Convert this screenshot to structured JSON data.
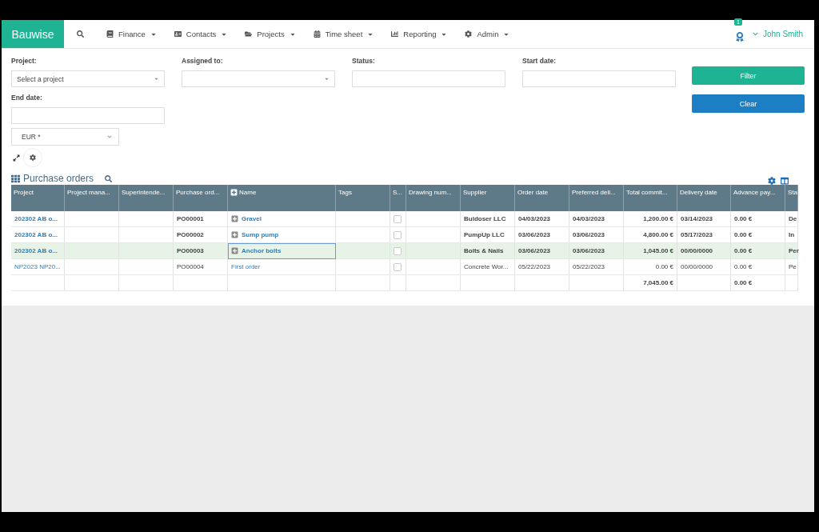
{
  "nav": {
    "brand": "Bauwise",
    "items": [
      {
        "label": "Finance"
      },
      {
        "label": "Contacts"
      },
      {
        "label": "Projects"
      },
      {
        "label": "Time sheet"
      },
      {
        "label": "Reporting"
      },
      {
        "label": "Admin"
      }
    ],
    "notification_count": "1",
    "user": "John Smith"
  },
  "filters": {
    "fields": [
      {
        "label": "Project:",
        "kind": "select",
        "placeholder": "Select a project"
      },
      {
        "label": "Assigned to:",
        "kind": "select"
      },
      {
        "label": "Status:",
        "kind": "input"
      },
      {
        "label": "Start date:",
        "kind": "input"
      },
      {
        "label": "End date:",
        "kind": "input"
      }
    ],
    "currency": "EUR *",
    "buttons": [
      {
        "label": "Filter",
        "kind": "primary"
      },
      {
        "label": "Clear",
        "kind": "secondary"
      }
    ]
  },
  "table": {
    "title": "Purchase orders",
    "columns": [
      "Project",
      "Project mana...",
      "Superintende...",
      "Purchase ord...",
      "Name",
      "Tags",
      "S...",
      "Drawing num...",
      "Supplier",
      "Order date",
      "Preferred deli...",
      "Total commit...",
      "Delivery date",
      "Advance pay...",
      "Sta"
    ],
    "rows": [
      {
        "selected": false,
        "bold": true,
        "project": "202302 AB o...",
        "purchase_order": "PO00001",
        "name": "Gravel",
        "expandable": true,
        "checked": false,
        "supplier": "Buldoser LLC",
        "order_date": "04/03/2023",
        "preferred_delivery": "04/03/2023",
        "total": "1,200.00 €",
        "delivery_date": "03/14/2023",
        "advance": "0.00 €",
        "status": "De"
      },
      {
        "selected": false,
        "bold": true,
        "project": "202302 AB o...",
        "purchase_order": "PO00002",
        "name": "Sump pump",
        "expandable": true,
        "checked": false,
        "supplier": "PumpUp LLC",
        "order_date": "03/06/2023",
        "preferred_delivery": "03/06/2023",
        "total": "4,800.00 €",
        "delivery_date": "05/17/2023",
        "advance": "0.00 €",
        "status": "In"
      },
      {
        "selected": true,
        "bold": true,
        "project": "202302 AB o...",
        "purchase_order": "PO00003",
        "name": "Anchor bolts",
        "expandable": true,
        "checked": false,
        "supplier": "Bolts & Nails",
        "order_date": "03/06/2023",
        "preferred_delivery": "03/06/2023",
        "total": "1,045.00 €",
        "delivery_date": "00/00/0000",
        "advance": "0.00 €",
        "status": "Per"
      },
      {
        "selected": false,
        "bold": false,
        "project": "NP2023 NP20...",
        "purchase_order": "PO00004",
        "name": "First order",
        "expandable": false,
        "checked": false,
        "supplier": "Concrete Wor...",
        "order_date": "05/22/2023",
        "preferred_delivery": "05/22/2023",
        "total": "0.00 €",
        "delivery_date": "00/00/0000",
        "advance": "0.00 €",
        "status": "Pe"
      }
    ],
    "totals": {
      "total": "7,045.00 €",
      "advance": "0.00 €"
    }
  }
}
